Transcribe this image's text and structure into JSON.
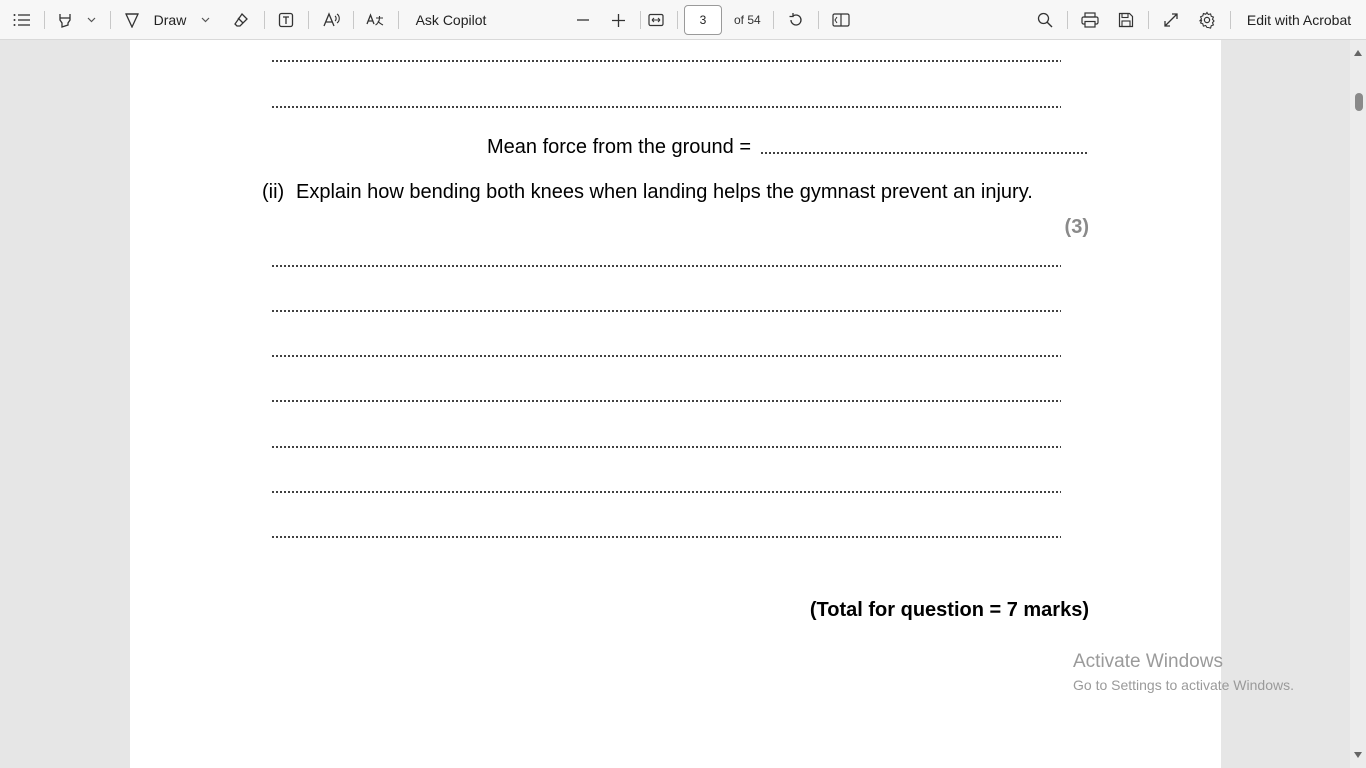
{
  "toolbar": {
    "draw_label": "Draw",
    "ask_copilot_label": "Ask Copilot",
    "page_current": "3",
    "page_total": "of 54",
    "edit_acrobat_label": "Edit with Acrobat",
    "icons": [
      "contents-icon",
      "highlight-icon",
      "chevron-down-icon",
      "draw-icon",
      "chevron-down-icon",
      "eraser-icon",
      "text-box-icon",
      "read-aloud-icon",
      "translate-icon",
      "zoom-out-icon",
      "zoom-in-icon",
      "fit-page-icon",
      "rotate-icon",
      "page-view-icon",
      "search-icon",
      "print-icon",
      "save-icon",
      "fullscreen-icon",
      "settings-icon"
    ]
  },
  "document": {
    "mean_force_label": "Mean force from the ground =",
    "question_ii_number": "(ii)",
    "question_ii_text": "Explain how bending both knees when landing helps the gymnast prevent an injury.",
    "question_ii_marks": "(3)",
    "total_label": "(Total for question = 7 marks)"
  },
  "watermark": {
    "title": "Activate Windows",
    "subtitle": "Go to Settings to activate Windows."
  }
}
